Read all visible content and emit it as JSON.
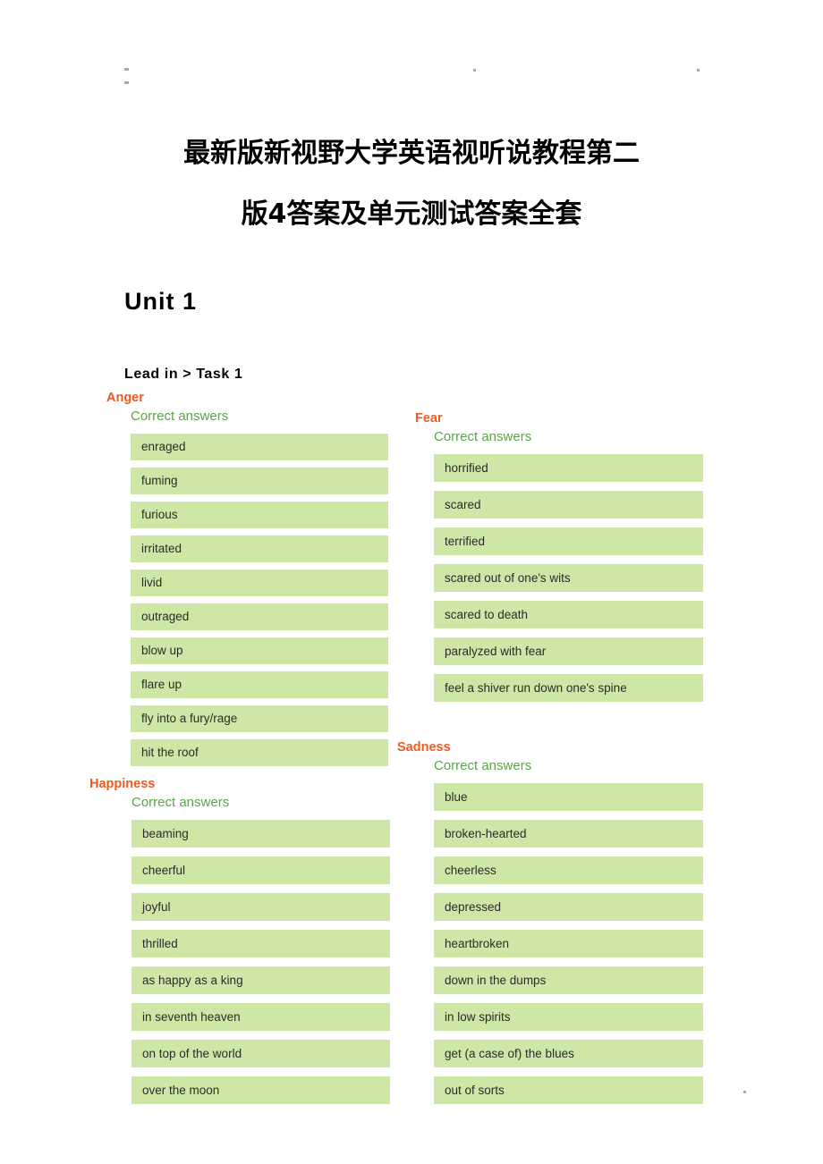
{
  "document": {
    "title_line1": "最新版新视野大学英语视听说教程第二",
    "title_line2": "版4答案及单元测试答案全套",
    "unit_heading": "Unit 1",
    "section_heading": "Lead in > Task 1"
  },
  "colors": {
    "group_title": "#f05a20",
    "sub_label": "#5aa546",
    "chip_background": "#cfe7a6",
    "chip_text": "#2b2b2b",
    "page_background": "#ffffff"
  },
  "groups": [
    {
      "id": "anger",
      "title": "Anger",
      "sub": "Correct answers",
      "answers": [
        "enraged",
        "fuming",
        "furious",
        "irritated",
        "livid",
        "outraged",
        "blow up",
        "flare up",
        "fly into a fury/rage",
        "hit the roof"
      ]
    },
    {
      "id": "fear",
      "title": "Fear",
      "sub": "Correct answers",
      "answers": [
        "horrified",
        "scared",
        "terrified",
        "scared out of one's wits",
        "scared to death",
        "paralyzed with fear",
        "feel a shiver run down one's spine"
      ]
    },
    {
      "id": "happiness",
      "title": "Happiness",
      "sub": "Correct answers",
      "answers": [
        "beaming",
        "cheerful",
        "joyful",
        "thrilled",
        "as happy as a king",
        "in seventh heaven",
        "on top of the world",
        "over the moon"
      ]
    },
    {
      "id": "sadness",
      "title": "Sadness",
      "sub": "Correct answers",
      "answers": [
        "blue",
        "broken-hearted",
        "cheerless",
        "depressed",
        "heartbroken",
        "down in the dumps",
        "in low spirits",
        "get (a case of) the blues",
        "out of sorts"
      ]
    }
  ]
}
